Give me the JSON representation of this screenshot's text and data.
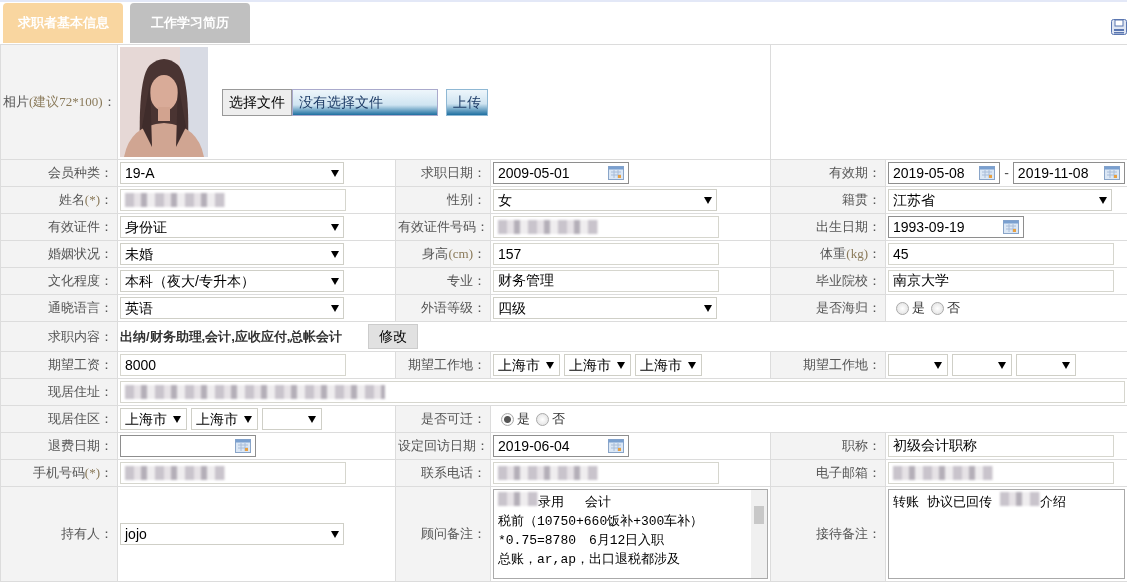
{
  "tabs": [
    {
      "label": "求职者基本信息",
      "selected": true
    },
    {
      "label": "工作学习简历",
      "selected": false
    }
  ],
  "photo_row": {
    "label": "相片",
    "note": "(建议72*100)",
    "tail": "：",
    "choose_button": "选择文件",
    "file_status": "没有选择文件",
    "upload_button": "上传"
  },
  "rows": [
    {
      "cells": [
        {
          "label": "会员种类：",
          "controls": [
            {
              "kind": "select",
              "value": "19-A"
            }
          ]
        },
        {
          "label": "求职日期：",
          "controls": [
            {
              "kind": "date",
              "value": "2009-05-01"
            }
          ]
        },
        {
          "label": "有效期：",
          "controls": [
            {
              "kind": "date",
              "value": "2019-05-08"
            },
            {
              "kind": "separator",
              "text": "-"
            },
            {
              "kind": "date",
              "value": "2019-11-08"
            }
          ]
        }
      ]
    },
    {
      "cells": [
        {
          "label": "姓名",
          "note": "(*)",
          "tail": "：",
          "controls": [
            {
              "kind": "text",
              "redacted": true
            }
          ]
        },
        {
          "label": "性别：",
          "controls": [
            {
              "kind": "select",
              "value": "女"
            }
          ]
        },
        {
          "label": "籍贯：",
          "controls": [
            {
              "kind": "select",
              "value": "江苏省"
            }
          ]
        }
      ]
    },
    {
      "cells": [
        {
          "label": "有效证件：",
          "controls": [
            {
              "kind": "select",
              "value": "身份证"
            }
          ]
        },
        {
          "label": "有效证件号码：",
          "controls": [
            {
              "kind": "text",
              "redacted": true
            }
          ]
        },
        {
          "label": "出生日期：",
          "controls": [
            {
              "kind": "date",
              "value": "1993-09-19"
            }
          ]
        }
      ]
    },
    {
      "cells": [
        {
          "label": "婚姻状况：",
          "controls": [
            {
              "kind": "select",
              "value": "未婚"
            }
          ]
        },
        {
          "label": "身高",
          "note": "(cm)",
          "tail": "：",
          "controls": [
            {
              "kind": "text",
              "value": "157"
            }
          ]
        },
        {
          "label": "体重",
          "note": "(kg)",
          "tail": "：",
          "controls": [
            {
              "kind": "text",
              "value": "45"
            }
          ]
        }
      ]
    },
    {
      "cells": [
        {
          "label": "文化程度：",
          "controls": [
            {
              "kind": "select",
              "value": "本科（夜大/专升本）"
            }
          ]
        },
        {
          "label": "专业：",
          "controls": [
            {
              "kind": "text",
              "value": "财务管理"
            }
          ]
        },
        {
          "label": "毕业院校：",
          "controls": [
            {
              "kind": "text",
              "value": "南京大学"
            }
          ]
        }
      ]
    },
    {
      "cells": [
        {
          "label": "通晓语言：",
          "controls": [
            {
              "kind": "select",
              "value": "英语"
            }
          ]
        },
        {
          "label": "外语等级：",
          "controls": [
            {
              "kind": "select",
              "value": "四级"
            }
          ]
        },
        {
          "label": "是否海归：",
          "controls": [
            {
              "kind": "radio",
              "options": [
                {
                  "label": "是",
                  "selected": false
                },
                {
                  "label": "否",
                  "selected": false
                }
              ]
            }
          ]
        }
      ]
    },
    {
      "cells": [
        {
          "label": "求职内容：",
          "controls": [
            {
              "kind": "bold_text",
              "text": "出纳/财务助理,会计,应收应付,总帐会计"
            },
            {
              "kind": "button",
              "text": "修改"
            }
          ]
        }
      ]
    },
    {
      "cells": [
        {
          "label": "期望工资：",
          "controls": [
            {
              "kind": "text",
              "value": "8000"
            }
          ]
        },
        {
          "label": "期望工作地：",
          "controls": [
            {
              "kind": "select",
              "value": "上海市"
            },
            {
              "kind": "select",
              "value": "上海市"
            },
            {
              "kind": "select",
              "value": "上海市"
            }
          ]
        },
        {
          "label": "期望工作地：",
          "controls": [
            {
              "kind": "select"
            },
            {
              "kind": "select"
            },
            {
              "kind": "select"
            }
          ]
        }
      ]
    },
    {
      "cells": [
        {
          "label": "现居住址：",
          "controls": [
            {
              "kind": "text",
              "redacted": true
            }
          ]
        }
      ]
    },
    {
      "cells": [
        {
          "label": "现居住区：",
          "controls": [
            {
              "kind": "select",
              "value": "上海市"
            },
            {
              "kind": "select",
              "value": "上海市"
            },
            {
              "kind": "select"
            }
          ]
        },
        {
          "label": "是否可迁：",
          "controls": [
            {
              "kind": "radio",
              "options": [
                {
                  "label": "是",
                  "selected": true
                },
                {
                  "label": "否",
                  "selected": false
                }
              ]
            }
          ]
        }
      ]
    },
    {
      "cells": [
        {
          "label": "退费日期：",
          "controls": [
            {
              "kind": "date"
            }
          ]
        },
        {
          "label": "设定回访日期：",
          "controls": [
            {
              "kind": "date",
              "value": "2019-06-04"
            }
          ]
        },
        {
          "label": "职称：",
          "controls": [
            {
              "kind": "text",
              "value": "初级会计职称"
            }
          ]
        }
      ]
    },
    {
      "cells": [
        {
          "label": "手机号码",
          "note": "(*)",
          "tail": "：",
          "controls": [
            {
              "kind": "text",
              "redacted": true
            }
          ]
        },
        {
          "label": "联系电话：",
          "controls": [
            {
              "kind": "text",
              "redacted": true
            }
          ]
        },
        {
          "label": "电子邮箱：",
          "controls": [
            {
              "kind": "text",
              "redacted": true
            }
          ]
        }
      ]
    },
    {
      "cells": [
        {
          "label": "持有人：",
          "controls": [
            {
              "kind": "select",
              "value": "jojo"
            }
          ]
        },
        {
          "label": "顾问备注：",
          "controls": [
            {
              "kind": "textarea",
              "lines": [
                [
                  {
                    "kind": "redacted"
                  },
                  {
                    "kind": "text",
                    "text": "录用　 会计"
                  }
                ],
                [
                  {
                    "kind": "text",
                    "text": "税前（10750+660饭补+300车补）"
                  }
                ],
                [
                  {
                    "kind": "text",
                    "text": "*0.75=8780　6月12日入职"
                  }
                ],
                [
                  {
                    "kind": "text",
                    "text": "总账，ar,ap，出口退税都涉及"
                  }
                ]
              ]
            }
          ]
        },
        {
          "label": "接待备注：",
          "controls": [
            {
              "kind": "textarea",
              "lines": [
                [
                  {
                    "kind": "text",
                    "text": "转账  协议已回传 "
                  },
                  {
                    "kind": "redacted"
                  },
                  {
                    "kind": "text",
                    "text": "介绍"
                  }
                ]
              ]
            }
          ]
        }
      ]
    }
  ]
}
